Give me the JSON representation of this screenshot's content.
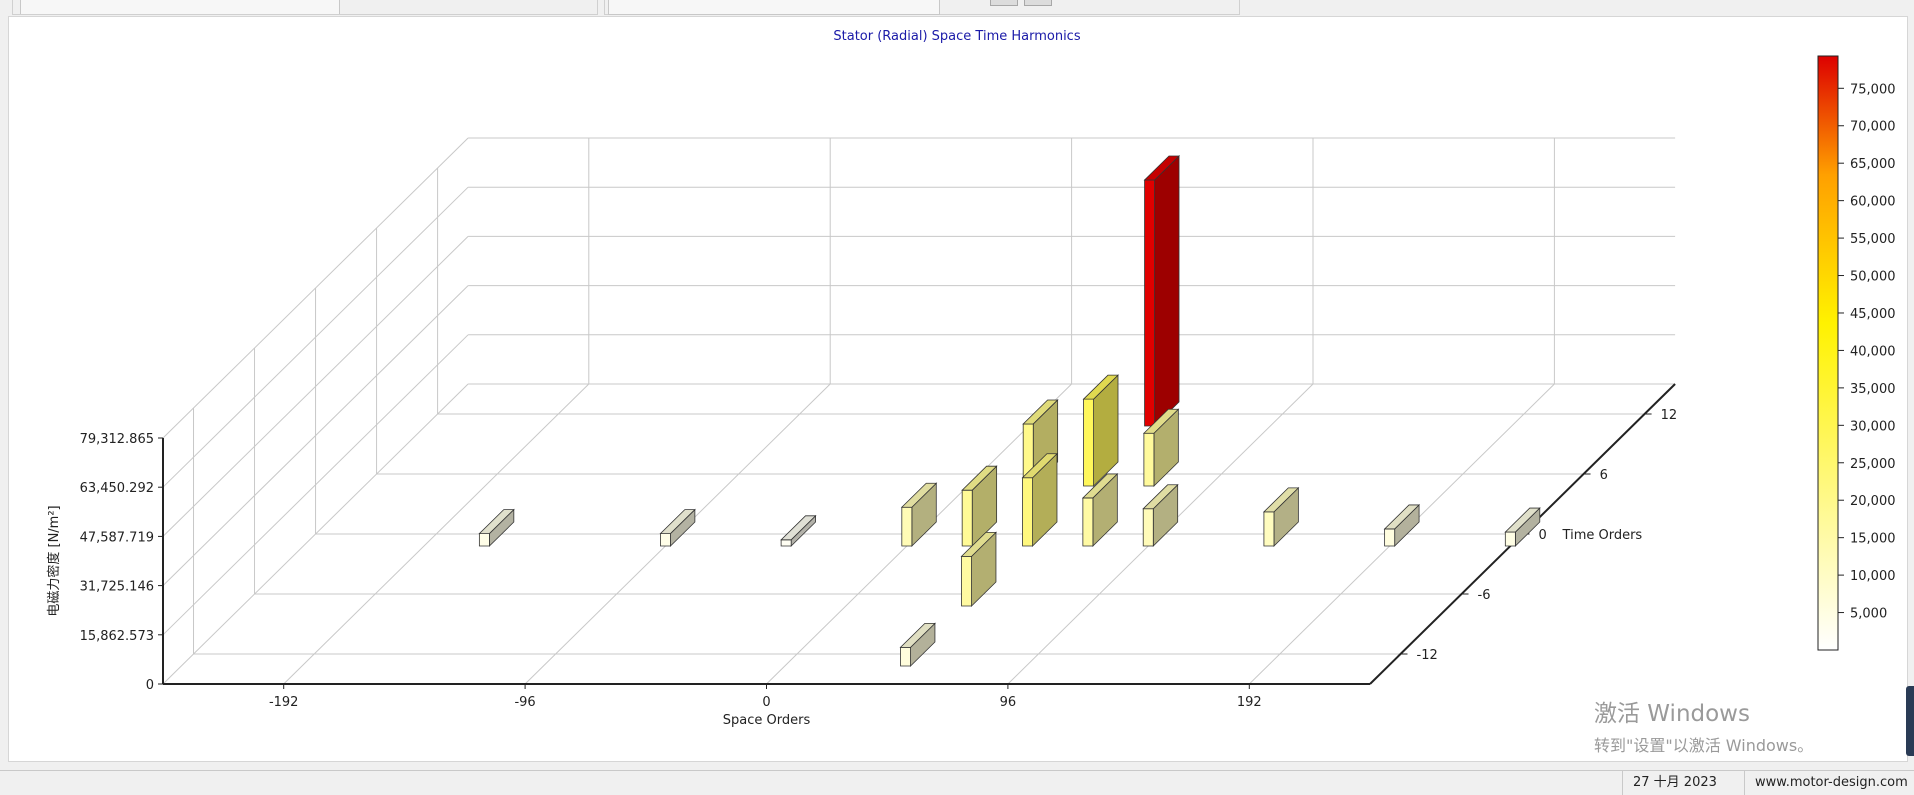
{
  "window": {
    "status_date": "27 十月 2023",
    "status_site": "www.motor-design.com"
  },
  "watermark": {
    "line1": "激活 Windows",
    "line2": "转到\"设置\"以激活 Windows。"
  },
  "chart_data": {
    "type": "bar3d",
    "title": "Stator (Radial) Space Time Harmonics",
    "xlabel": "Space Orders",
    "ylabel": "Time Orders",
    "zlabel": "电磁力密度 [N/m²]",
    "x_ticks": [
      -192,
      -96,
      0,
      96,
      192
    ],
    "y_ticks": [
      -12,
      -6,
      0,
      6,
      12
    ],
    "z_ticks": [
      "0",
      "15,862.573",
      "31,725.146",
      "47,587.719",
      "63,450.292",
      "79,312.865"
    ],
    "x_range": [
      -240,
      240
    ],
    "y_range": [
      -15,
      15
    ],
    "z_range": [
      0,
      79312.865
    ],
    "colorbar": {
      "min": 0,
      "max": 79312.865,
      "ticks": [
        "5,000",
        "10,000",
        "15,000",
        "20,000",
        "25,000",
        "30,000",
        "35,000",
        "40,000",
        "45,000",
        "50,000",
        "55,000",
        "60,000",
        "65,000",
        "70,000",
        "75,000"
      ]
    },
    "colors": {
      "title": "#1a1aa8",
      "grid": "#c8c8c8",
      "axis": "#222222",
      "low": "#ffffff",
      "mid": "#fff200",
      "high": "#e00000"
    },
    "bars": [
      {
        "x": 48,
        "y": 12,
        "z": 79312
      },
      {
        "x": 48,
        "y": 6,
        "z": 28000
      },
      {
        "x": 48,
        "y": 0,
        "z": 22000
      },
      {
        "x": 48,
        "y": -6,
        "z": 16000
      },
      {
        "x": 48,
        "y": -12,
        "z": 6000
      },
      {
        "x": 0,
        "y": 0,
        "z": 12500
      },
      {
        "x": 24,
        "y": 6,
        "z": 20000
      },
      {
        "x": 24,
        "y": 0,
        "z": 18000
      },
      {
        "x": 72,
        "y": 6,
        "z": 17000
      },
      {
        "x": 72,
        "y": 0,
        "z": 15500
      },
      {
        "x": 96,
        "y": 0,
        "z": 12000
      },
      {
        "x": 144,
        "y": 0,
        "z": 11000
      },
      {
        "x": -96,
        "y": 0,
        "z": 4000
      },
      {
        "x": -168,
        "y": 0,
        "z": 4000
      },
      {
        "x": -48,
        "y": 0,
        "z": 2000
      },
      {
        "x": 192,
        "y": 0,
        "z": 5500
      },
      {
        "x": 240,
        "y": 0,
        "z": 4500
      }
    ]
  }
}
